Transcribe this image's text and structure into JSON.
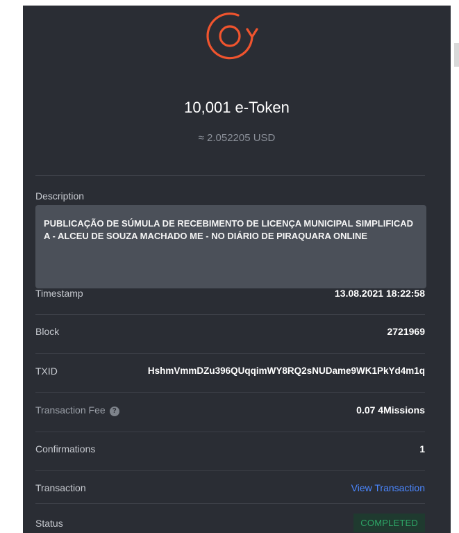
{
  "transaction": {
    "amount": "10,001 e-Token",
    "fiat_equivalent": "≈ 2.052205 USD"
  },
  "description": {
    "label": "Description",
    "text": "PUBLICAÇÃO DE SÚMULA DE RECEBIMENTO DE LICENÇA MUNICIPAL SIMPLIFICADA - ALCEU DE SOUZA MACHADO ME - NO DIÁRIO DE PIRAQUARA ONLINE"
  },
  "details": {
    "timestamp_label": "Timestamp",
    "timestamp_value": "13.08.2021 18:22:58",
    "block_label": "Block",
    "block_value": "2721969",
    "txid_label": "TXID",
    "txid_value": "HshmVmmDZu396QUqqimWY8RQ2sNUDame9WK1PkYd4m1q",
    "fee_label": "Transaction Fee",
    "fee_help_icon": "question-circle-icon",
    "fee_value": "0.07 4Missions",
    "confirmations_label": "Confirmations",
    "confirmations_value": "1",
    "transaction_label": "Transaction",
    "transaction_link": "View Transaction",
    "status_label": "Status",
    "status_value": "COMPLETED"
  },
  "colors": {
    "panel_bg": "#2a2d34",
    "icon_accent": "#f0542e",
    "link": "#4b87ff",
    "status_green": "#2ea566"
  }
}
